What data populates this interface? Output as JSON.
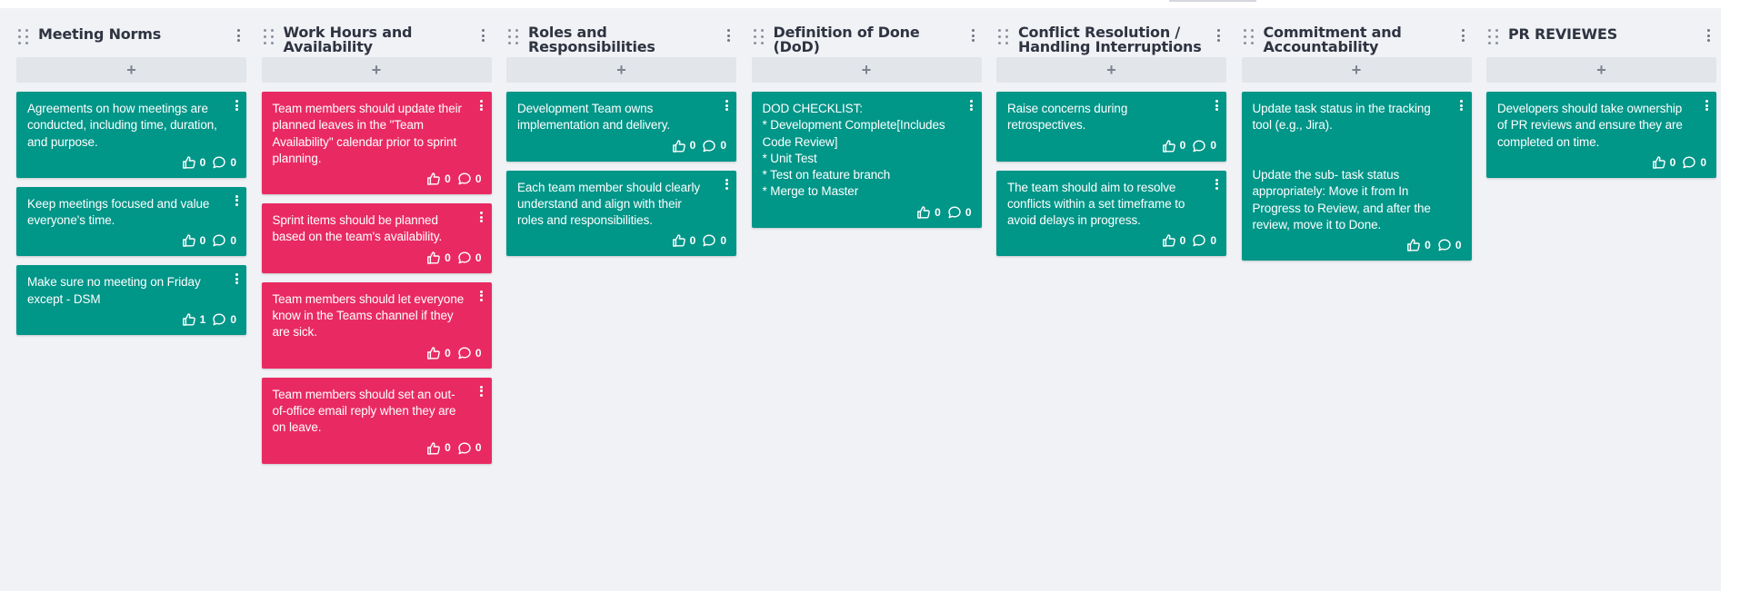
{
  "columns": [
    {
      "title": "Meeting Norms",
      "add_label": "+",
      "cards": [
        {
          "color": "green",
          "text": "Agreements on how meetings are conducted, including time, duration, and purpose.",
          "likes": "0",
          "comments": "0"
        },
        {
          "color": "green",
          "text": "Keep meetings focused and value everyone's time.",
          "likes": "0",
          "comments": "0"
        },
        {
          "color": "green",
          "text": "Make sure no meeting on Friday except - DSM",
          "likes": "1",
          "comments": "0"
        }
      ]
    },
    {
      "title": "Work Hours and Availability",
      "add_label": "+",
      "cards": [
        {
          "color": "pink",
          "text": "Team members should update their planned leaves in the \"Team Availability\" calendar prior to sprint planning.",
          "likes": "0",
          "comments": "0"
        },
        {
          "color": "pink",
          "text": "Sprint items should be planned based on the team's availability.",
          "likes": "0",
          "comments": "0"
        },
        {
          "color": "pink",
          "text": "Team members should let everyone know in the Teams channel if they are sick.",
          "likes": "0",
          "comments": "0"
        },
        {
          "color": "pink",
          "text": "Team members should set an out-of-office email reply when they are on leave.",
          "likes": "0",
          "comments": "0"
        }
      ]
    },
    {
      "title": "Roles and Responsibilities",
      "add_label": "+",
      "cards": [
        {
          "color": "green",
          "text": "Development Team owns implementation and delivery.",
          "likes": "0",
          "comments": "0"
        },
        {
          "color": "green",
          "text": "Each team member should clearly understand and align with their roles and responsibilities.",
          "likes": "0",
          "comments": "0"
        }
      ]
    },
    {
      "title": "Definition of Done (DoD)",
      "add_label": "+",
      "cards": [
        {
          "color": "green",
          "text": "DOD CHECKLIST:\n* Development Complete[Includes Code Review]\n* Unit Test\n* Test on feature branch\n* Merge to Master",
          "likes": "0",
          "comments": "0"
        }
      ]
    },
    {
      "title": "Conflict Resolution / Handling Interruptions",
      "add_label": "+",
      "cards": [
        {
          "color": "green",
          "text": "Raise concerns during retrospectives.",
          "likes": "0",
          "comments": "0"
        },
        {
          "color": "green",
          "text": "The team should aim to resolve conflicts within a set timeframe to avoid delays in progress.",
          "likes": "0",
          "comments": "0"
        }
      ]
    },
    {
      "title": "Commitment and Accountability",
      "add_label": "+",
      "cards": [
        {
          "color": "green",
          "text": "Update task status in the tracking tool (e.g., Jira).\n\n\nUpdate the sub- task status appropriately: Move it from In Progress to Review, and after the review, move it to Done.",
          "likes": "0",
          "comments": "0"
        }
      ]
    },
    {
      "title": "PR REVIEWES",
      "add_label": "+",
      "cards": [
        {
          "color": "green",
          "text": "Developers should take ownership of PR reviews and ensure they are completed on time.",
          "likes": "0",
          "comments": "0"
        }
      ]
    }
  ],
  "icons": {
    "drag": "drag-handle-icon",
    "menu": "kebab-menu-icon",
    "like": "thumbs-up-icon",
    "comment": "comment-bubble-icon"
  },
  "colors": {
    "green": "#009688",
    "pink": "#e92a62",
    "board_bg": "#f0f2f6"
  }
}
